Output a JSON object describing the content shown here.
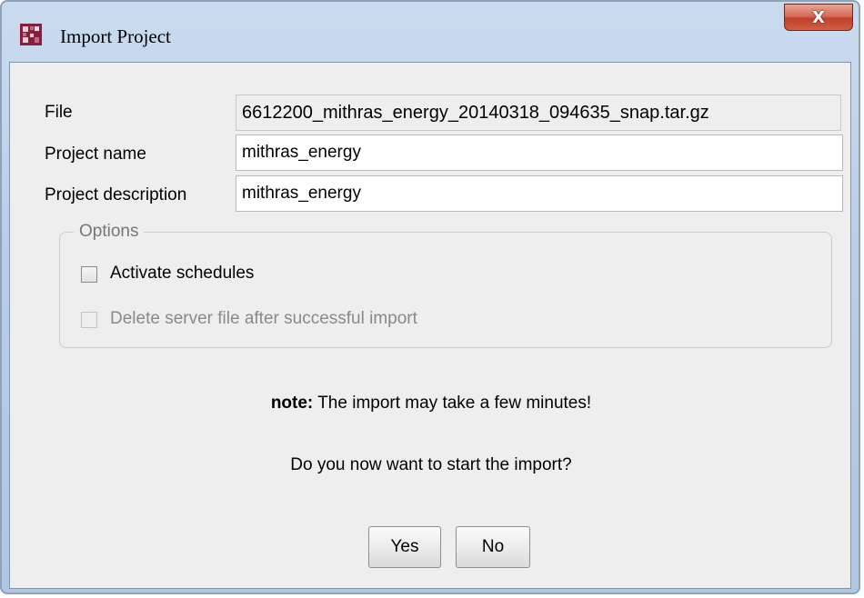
{
  "window": {
    "title": "Import Project",
    "app_icon": "firstspirit-logo-icon",
    "close_glyph": "X"
  },
  "form": {
    "file_label": "File",
    "file_value": "6612200_mithras_energy_20140318_094635_snap.tar.gz",
    "name_label": "Project name",
    "name_value": "mithras_energy",
    "description_label": "Project description",
    "description_value": "mithras_energy"
  },
  "options": {
    "legend": "Options",
    "activate_schedules": {
      "label": "Activate schedules",
      "checked": false,
      "enabled": true
    },
    "delete_server_file": {
      "label": "Delete server file after successful import",
      "checked": false,
      "enabled": false
    }
  },
  "message": {
    "note_prefix": "note:",
    "note_text": " The import may take a few minutes!",
    "question": "Do you now want to start the import?"
  },
  "buttons": {
    "yes": "Yes",
    "no": "No"
  },
  "colors": {
    "title_bar": "#b9cfe7",
    "dialog_bg": "#eeeeee",
    "close_button": "#c2402a",
    "disabled_text": "#8a8a8a"
  }
}
